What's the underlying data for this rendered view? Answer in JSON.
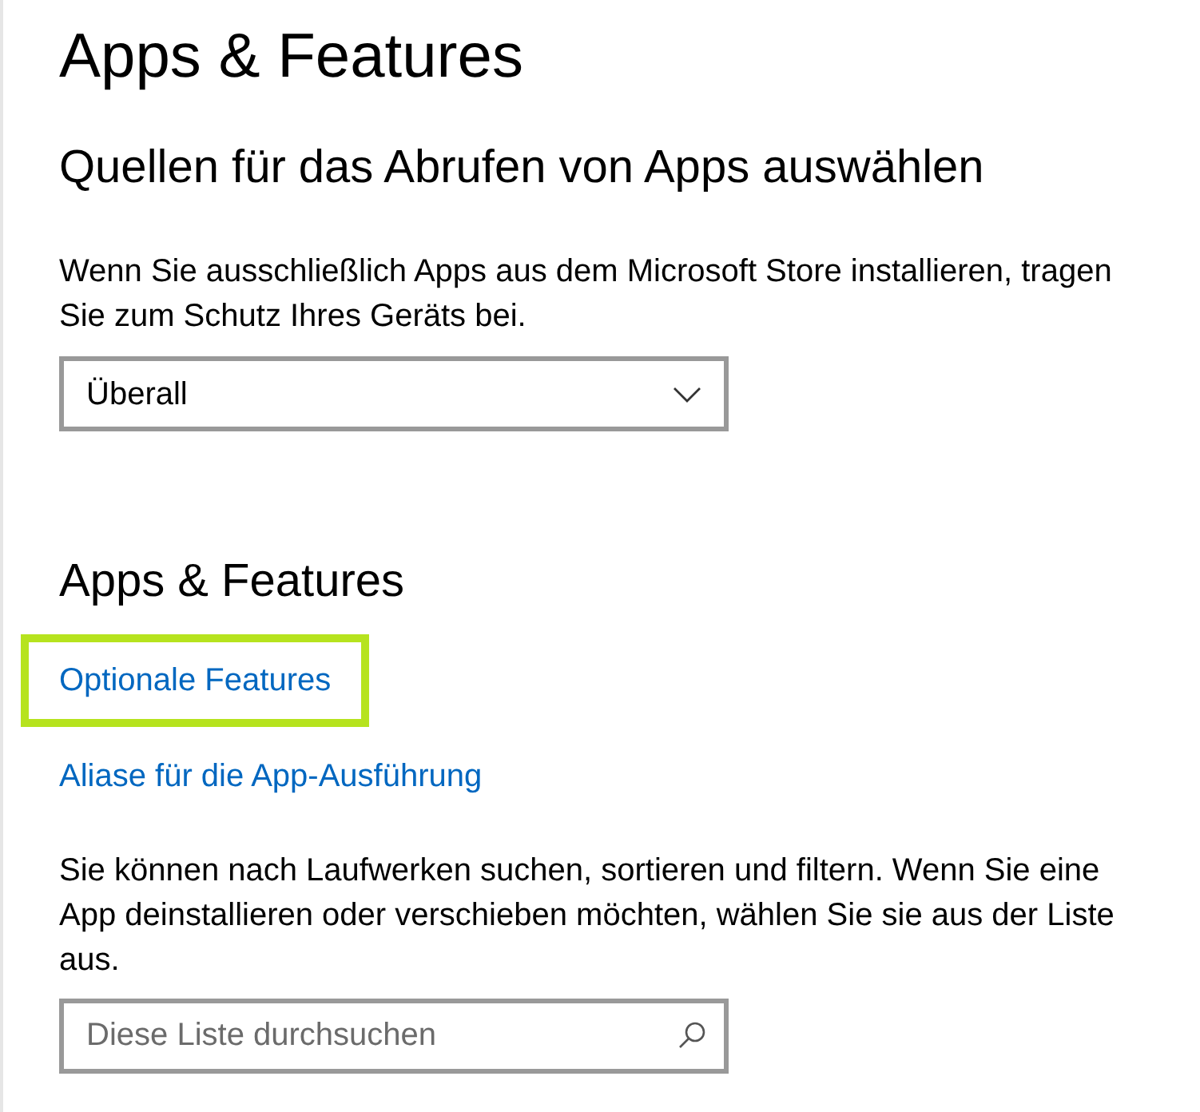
{
  "page_title": "Apps & Features",
  "sources": {
    "heading": "Quellen für das Abrufen von Apps auswählen",
    "description": "Wenn Sie ausschließlich Apps aus dem Microsoft Store installieren, tragen Sie zum Schutz Ihres Geräts bei.",
    "dropdown": {
      "value": "Überall"
    }
  },
  "apps": {
    "heading": "Apps & Features",
    "links": [
      {
        "label": "Optionale Features",
        "highlighted": true
      },
      {
        "label": "Aliase für die App-Ausführung",
        "highlighted": false
      }
    ],
    "description": "Sie können nach Laufwerken suchen, sortieren und filtern. Wenn Sie eine App deinstallieren oder verschieben möchten, wählen Sie sie aus der Liste aus.",
    "search": {
      "placeholder": "Diese Liste durchsuchen"
    }
  }
}
